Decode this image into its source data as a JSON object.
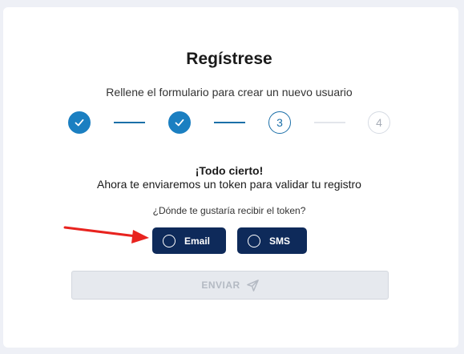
{
  "form": {
    "title": "Regístrese",
    "subtitle": "Rellene el formulario para crear un nuevo usuario"
  },
  "stepper": {
    "steps": [
      {
        "label": "",
        "state": "done"
      },
      {
        "label": "",
        "state": "done"
      },
      {
        "label": "3",
        "state": "current"
      },
      {
        "label": "4",
        "state": "pending"
      }
    ],
    "accent_color": "#1b7fc1"
  },
  "confirmation": {
    "heading": "¡Todo cierto!",
    "message": "Ahora te enviaremos un token para validar tu registro"
  },
  "token_choice": {
    "question": "¿Dónde te gustaría recibir el token?",
    "options": [
      {
        "label": "Email",
        "selected": false
      },
      {
        "label": "SMS",
        "selected": false
      }
    ],
    "option_color": "#0e2a5a"
  },
  "submit": {
    "label": "ENVIAR",
    "icon": "send-icon",
    "disabled": true
  },
  "annotation": {
    "arrow_color": "#e8231f"
  }
}
